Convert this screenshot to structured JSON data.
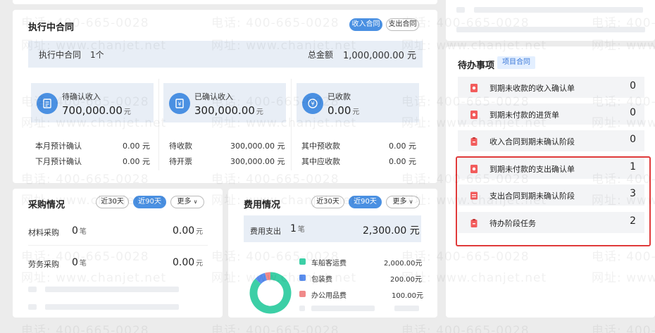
{
  "watermark": {
    "phone": "电话: 400-665-0028",
    "site": "网址: www.chanjet.net"
  },
  "contracts": {
    "title": "执行中合同",
    "tab_income": "收入合同",
    "tab_expense": "支出合同",
    "count_label": "执行中合同",
    "count_value": "1个",
    "total_label": "总金额",
    "total_value": "1,000,000.00 元",
    "stats": [
      {
        "label": "待确认收入",
        "value": "700,000.00",
        "unit": "元",
        "rows": [
          {
            "label": "本月预计确认",
            "value": "0.00 元"
          },
          {
            "label": "下月预计确认",
            "value": "0.00 元"
          }
        ]
      },
      {
        "label": "已确认收入",
        "value": "300,000.00",
        "unit": "元",
        "rows": [
          {
            "label": "待收款",
            "value": "300,000.00 元"
          },
          {
            "label": "待开票",
            "value": "300,000.00 元"
          }
        ]
      },
      {
        "label": "已收款",
        "value": "0.00",
        "unit": "元",
        "rows": [
          {
            "label": "其中预收款",
            "value": "0.00 元"
          },
          {
            "label": "其中应收款",
            "value": "0.00 元"
          }
        ]
      }
    ]
  },
  "purchase": {
    "title": "采购情况",
    "f30": "近30天",
    "f90": "近90天",
    "more": "更多",
    "rows": [
      {
        "label": "材料采购",
        "count": "0",
        "count_unit": "笔",
        "amount": "0.00",
        "unit": "元"
      },
      {
        "label": "劳务采购",
        "count": "0",
        "count_unit": "笔",
        "amount": "0.00",
        "unit": "元"
      }
    ]
  },
  "expense": {
    "title": "费用情况",
    "f30": "近30天",
    "f90": "近90天",
    "more": "更多",
    "summary_label": "费用支出",
    "summary_count": "1",
    "summary_unit": "笔",
    "summary_amount": "2,300.00 元",
    "legend": [
      {
        "name": "车船客运费",
        "value": "2,000.00元",
        "color": "#3ccfa6"
      },
      {
        "name": "包装费",
        "value": "200.00元",
        "color": "#5b8ff0"
      },
      {
        "name": "办公用品费",
        "value": "100.00元",
        "color": "#f08a8a"
      }
    ],
    "pie": [
      2000,
      200,
      100
    ]
  },
  "todo": {
    "title": "待办事项",
    "tag": "项目合同",
    "items": [
      {
        "label": "到期未收款的收入确认单",
        "count": "0",
        "icon": "receipt-icon"
      },
      {
        "label": "到期未付款的进货单",
        "count": "0",
        "icon": "receipt-icon"
      },
      {
        "label": "收入合同到期未确认阶段",
        "count": "0",
        "icon": "clipboard-icon"
      },
      {
        "label": "到期未付款的支出确认单",
        "count": "1",
        "icon": "receipt-icon"
      },
      {
        "label": "支出合同到期未确认阶段",
        "count": "3",
        "icon": "document-icon"
      },
      {
        "label": "待办阶段任务",
        "count": "2",
        "icon": "clipboard-icon"
      }
    ],
    "highlight_color": "#e03a3a"
  },
  "colors": {
    "accent": "#4a90e2",
    "tag_bg": "#e3efff"
  }
}
